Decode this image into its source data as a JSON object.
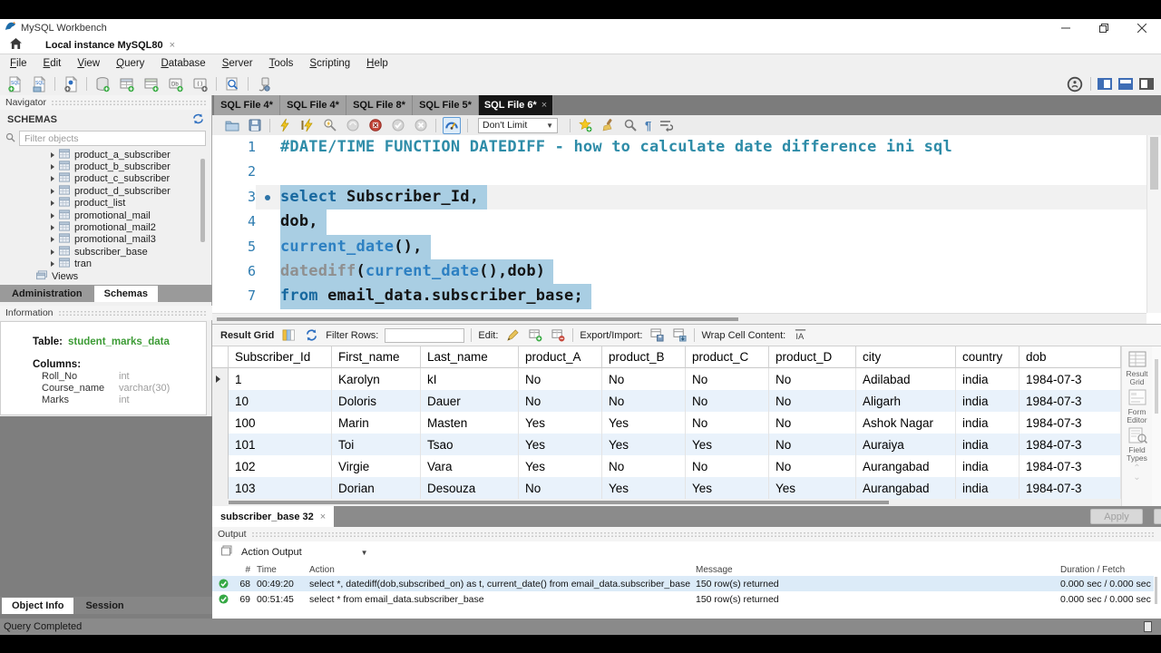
{
  "chrome": {
    "title": "MySQL Workbench",
    "connection_tab": "Local instance MySQL80",
    "menu": [
      "File",
      "Edit",
      "View",
      "Query",
      "Database",
      "Server",
      "Tools",
      "Scripting",
      "Help"
    ],
    "status": "Query Completed",
    "window_buttons": [
      "minimize",
      "restore",
      "close"
    ],
    "main_toolbar_icons": [
      "new-sql-editor",
      "open-sql-script",
      "inspector",
      "create-schema",
      "create-table",
      "create-view",
      "create-procedure",
      "create-function",
      "search-data",
      "reconnect"
    ]
  },
  "sql_tabs": {
    "labels": [
      "SQL File 4*",
      "SQL File 4*",
      "SQL File 8*",
      "SQL File 5*",
      "SQL File 6*"
    ],
    "active_index": 4
  },
  "editor_toolbar": {
    "limit": "Don't Limit"
  },
  "editor": {
    "lines": [
      {
        "n": "1",
        "seg": [
          [
            "c",
            "#DATE/TIME FUNCTION DATEDIFF - how to calculate date difference ini sql"
          ]
        ]
      },
      {
        "n": "2",
        "seg": []
      },
      {
        "n": "3",
        "marker": true,
        "cur": true,
        "sel": true,
        "seg": [
          [
            "k",
            "select"
          ],
          [
            "p",
            " Subscriber_Id,"
          ]
        ]
      },
      {
        "n": "4",
        "sel": true,
        "seg": [
          [
            "p",
            "dob,"
          ]
        ]
      },
      {
        "n": "5",
        "sel": true,
        "seg": [
          [
            "f",
            "current_date"
          ],
          [
            "p",
            "(),"
          ]
        ]
      },
      {
        "n": "6",
        "sel": true,
        "seg": [
          [
            "g",
            "datediff"
          ],
          [
            "p",
            "("
          ],
          [
            "f",
            "current_date"
          ],
          [
            "p",
            "(),dob)"
          ]
        ]
      },
      {
        "n": "7",
        "sel": true,
        "seg": [
          [
            "k",
            "from"
          ],
          [
            "p",
            " email_data.subscriber_base;"
          ]
        ]
      }
    ]
  },
  "navigator": {
    "header": "Navigator",
    "section": "SCHEMAS",
    "filter_placeholder": "Filter objects",
    "tables": [
      "product_a_subscriber",
      "product_b_subscriber",
      "product_c_subscriber",
      "product_d_subscriber",
      "product_list",
      "promotional_mail",
      "promotional_mail2",
      "promotional_mail3",
      "subscriber_base",
      "tran"
    ],
    "views_label": "Views",
    "tabs": [
      "Administration",
      "Schemas"
    ],
    "active_tab_index": 1
  },
  "information": {
    "header": "Information",
    "table_label": "Table:",
    "table_name": "student_marks_data",
    "columns_label": "Columns:",
    "columns": [
      [
        "Roll_No",
        "int"
      ],
      [
        "Course_name",
        "varchar(30)"
      ],
      [
        "Marks",
        "int"
      ]
    ]
  },
  "object_tabs": [
    "Object Info",
    "Session"
  ],
  "result": {
    "toolbar": {
      "grid_label": "Result Grid",
      "filter_label": "Filter Rows:",
      "edit_label": "Edit:",
      "export_label": "Export/Import:",
      "wrap_label": "Wrap Cell Content:"
    },
    "columns": [
      "Subscriber_Id",
      "First_name",
      "Last_name",
      "product_A",
      "product_B",
      "product_C",
      "product_D",
      "city",
      "country",
      "dob"
    ],
    "rows": [
      [
        "1",
        "Karolyn",
        "kI",
        "No",
        "No",
        "No",
        "No",
        "Adilabad",
        "india",
        "1984-07-3"
      ],
      [
        "10",
        "Doloris",
        "Dauer",
        "No",
        "No",
        "No",
        "No",
        "Aligarh",
        "india",
        "1984-07-3"
      ],
      [
        "100",
        "Marin",
        "Masten",
        "Yes",
        "Yes",
        "No",
        "No",
        "Ashok Nagar",
        "india",
        "1984-07-3"
      ],
      [
        "101",
        "Toi",
        "Tsao",
        "Yes",
        "Yes",
        "Yes",
        "No",
        "Auraiya",
        "india",
        "1984-07-3"
      ],
      [
        "102",
        "Virgie",
        "Vara",
        "Yes",
        "No",
        "No",
        "No",
        "Aurangabad",
        "india",
        "1984-07-3"
      ],
      [
        "103",
        "Dorian",
        "Desouza",
        "No",
        "Yes",
        "Yes",
        "Yes",
        "Aurangabad",
        "india",
        "1984-07-3"
      ]
    ],
    "side_tools": [
      "Result Grid",
      "Form Editor",
      "Field Types"
    ],
    "tab_label": "subscriber_base 32",
    "apply_label": "Apply"
  },
  "output": {
    "header": "Output",
    "selector": "Action Output",
    "columns": [
      "#",
      "Time",
      "Action",
      "Message",
      "Duration / Fetch"
    ],
    "rows": [
      [
        "68",
        "00:49:20",
        "select *, datediff(dob,subscribed_on) as t, current_date() from email_data.subscriber_base",
        "150 row(s) returned",
        "0.000 sec / 0.000 sec"
      ],
      [
        "69",
        "00:51:45",
        "select * from email_data.subscriber_base",
        "150 row(s) returned",
        "0.000 sec / 0.000 sec"
      ]
    ]
  },
  "colors": {
    "selection": "#a9cee3",
    "comment": "#2e8ca8",
    "keyword": "#17689f",
    "function": "#2d80c2",
    "table_name_green": "#3c9b35",
    "active_tab": "#161616",
    "alt_row": "#e9f2fb"
  }
}
